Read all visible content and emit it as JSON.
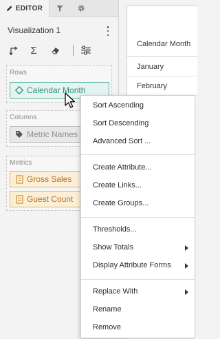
{
  "editor": {
    "tabs": {
      "editor_label": "EDITOR"
    },
    "viz_title": "Visualization 1",
    "icons": [
      "swap-axes-icon",
      "sigma-icon",
      "eraser-icon",
      "settings-sliders-icon",
      "kebab-menu-icon",
      "pencil-icon",
      "filter-icon",
      "gear-icon"
    ]
  },
  "zones": {
    "rows": {
      "label": "Rows",
      "item": "Calendar Month"
    },
    "columns": {
      "label": "Columns",
      "item": "Metric Names"
    },
    "metrics": {
      "label": "Metrics",
      "items": [
        "Gross Sales",
        "Guest Count"
      ]
    }
  },
  "grid": {
    "header": "Calendar Month",
    "rows": [
      "January",
      "February"
    ]
  },
  "context_menu": {
    "items": [
      "Sort Ascending",
      "Sort Descending",
      "Advanced Sort ...",
      "Create Attribute...",
      "Create Links...",
      "Create Groups...",
      "Thresholds...",
      "Show Totals",
      "Display Attribute Forms",
      "Replace With",
      "Rename",
      "Remove"
    ],
    "submenu_items": [
      "Show Totals",
      "Display Attribute Forms",
      "Replace With"
    ]
  },
  "colors": {
    "attribute": "#2f8f7f",
    "metric": "#b9731b",
    "panel_bg": "#f3f3f3"
  }
}
